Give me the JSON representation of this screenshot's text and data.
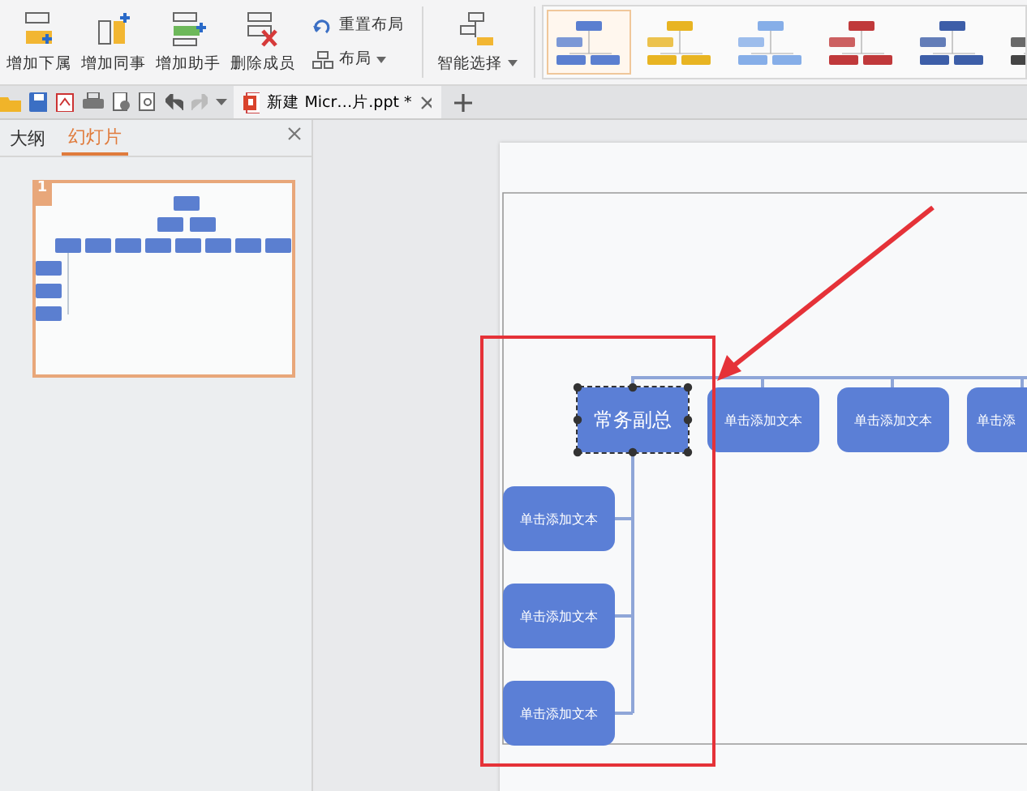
{
  "ribbon": {
    "buttons": [
      {
        "label": "增加下属",
        "kind": "subordinate"
      },
      {
        "label": "增加同事",
        "kind": "colleague"
      },
      {
        "label": "增加助手",
        "kind": "assistant"
      },
      {
        "label": "删除成员",
        "kind": "delete"
      }
    ],
    "small_buttons": [
      {
        "label": "重置布局",
        "kind": "reset",
        "dropdown": false
      },
      {
        "label": "布局",
        "kind": "layout",
        "dropdown": true
      }
    ],
    "smart_select": {
      "label": "智能选择",
      "dropdown": true
    },
    "styles": [
      {
        "color": "#5b7fd0",
        "selected": true
      },
      {
        "color": "#e8b422",
        "selected": false
      },
      {
        "color": "#86aee8",
        "selected": false
      },
      {
        "color": "#c0393b",
        "selected": false
      },
      {
        "color": "#3d5ea8",
        "selected": false
      },
      {
        "color": "#454545",
        "selected": false
      }
    ]
  },
  "document_tabs": [
    {
      "title": "新建 Micr…片.ppt *",
      "selected": true
    }
  ],
  "panel": {
    "tabs": [
      {
        "label": "大纲",
        "selected": false
      },
      {
        "label": "幻灯片",
        "selected": true
      }
    ],
    "slides": [
      {
        "number": "1",
        "selected": true
      }
    ]
  },
  "slide": {
    "selected_node": {
      "text": "常务副总",
      "selected": true
    },
    "top_row": [
      {
        "text": "单击添加文本"
      },
      {
        "text": "单击添加文本"
      },
      {
        "text": "单击添"
      }
    ],
    "side_column": [
      {
        "text": "单击添加文本"
      },
      {
        "text": "单击添加文本"
      },
      {
        "text": "单击添加文本"
      }
    ]
  }
}
